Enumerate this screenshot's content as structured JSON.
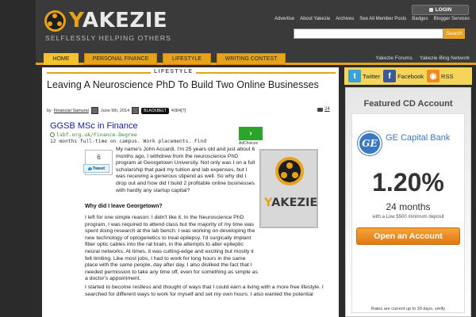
{
  "header": {
    "logo_text_y": "Y",
    "logo_text_rest": "AKEZIE",
    "tagline": "SELFLESSLY HELPING OTHERS",
    "login_label": "LOGIN",
    "topnav": [
      "Advertise",
      "About Yakezie",
      "Archives",
      "See All Member Posts",
      "Badges",
      "Blogger Services"
    ],
    "search": {
      "value": "",
      "button": "Search"
    }
  },
  "nav": {
    "tabs": [
      "HOME",
      "PERSONAL FINANCE",
      "LIFESTYLE",
      "WRITING CONTEST"
    ],
    "active_tab": "HOME",
    "right_links": [
      "Yakezie Forums",
      "Yakezie Blog Network"
    ]
  },
  "post": {
    "category": "LIFESTYLE",
    "title": "Leaving A Neuroscience PhD To Build Two Online Businesses",
    "by": "by",
    "author": "Financial Samurai",
    "date": "June 9th, 2014",
    "badge": "BLACKBELT",
    "rank": "4084[?]",
    "comment_count": "24",
    "ad": {
      "title": "GGSB MSc in Finance",
      "url": "lsbf.org.uk/Finance-Degree",
      "text": "12 months full-time on campus. Work placements. Find",
      "adchoices": "AdChoices"
    },
    "share_count": "6",
    "tweet_label": "Tweet",
    "paragraph1": "My name's John Accardi. I'm 25 years old and just about 6 months ago, I withdrew from the neuroscience PhD program at Georgetown University. Not only was I on a full scholarship that paid my tuition and lab expenses, but I was receiving a generous stipend as well. So why did I drop out and how did I build 2 profitable online businesses with hardly any startup capital?",
    "heading1": "Why did I leave Georgetown?",
    "paragraph2": "I left for one simple reason: I didn't like it. In the Neuroscience PhD program, I was required to attend class but the majority of my time was spent doing research at the lab bench. I was working on developing the new technology of optogenetics to treat epilepsy. I'd surgically implant fiber optic cables into the rat brain, in the attempts to alter epileptic neural networks. At times, it was cutting-edge and exciting but mostly it felt limiting. Like most jobs, I had to work for long hours in the same place with the same people, day after day. I also disliked the fact that I needed permission to take any time off, even for something as simple as a doctor's appointment.",
    "paragraph3": "I started to become restless and thought of ways that I could earn a living with a more free lifestyle. I searched for different ways to work for myself and set my own hours. I also wanted the potential",
    "image_word_y": "Y",
    "image_word_rest": "AKEZIE"
  },
  "sidebar": {
    "social": [
      "Twitter",
      "Facebook",
      "RSS"
    ],
    "cd": {
      "heading": "Featured CD Account",
      "logo_text": "GE",
      "bank_name": "GE Capital Bank",
      "rate": "1.20%",
      "term": "24 months",
      "minimum": "with a Low $500 minimum deposit",
      "button": "Open an Account",
      "note": "Rates are current up to 30 days, verify"
    }
  },
  "colors": {
    "accent": "#e5a21a",
    "header_bg": "#3a3a3a",
    "link_blue": "#1a1ab6",
    "ge_blue": "#3a78c2",
    "cta_orange": "#e07914"
  }
}
